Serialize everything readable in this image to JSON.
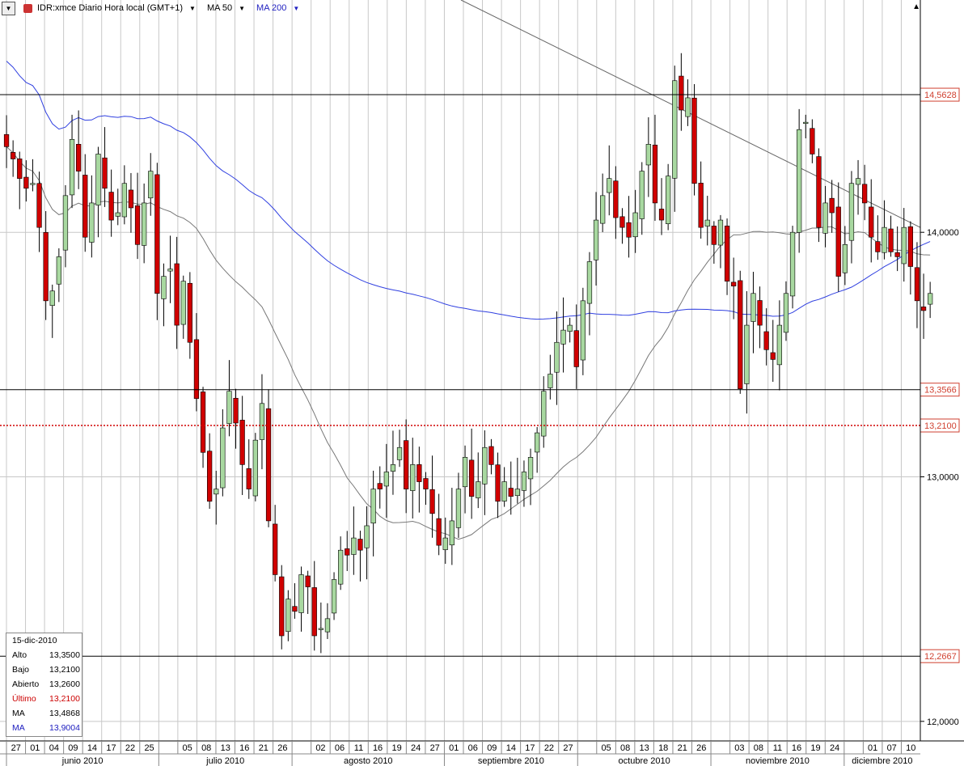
{
  "toolbar": {
    "symbol": "IDR:xmce Diario Hora local (GMT+1)",
    "ma50_label": "MA 50",
    "ma200_label": "MA 200",
    "ma50_color": "#000000",
    "ma200_color": "#2020c0"
  },
  "info": {
    "date": "15-dic-2010",
    "rows": [
      {
        "label": "Alto",
        "value": "13,3500",
        "color": "#000000"
      },
      {
        "label": "Bajo",
        "value": "13,2100",
        "color": "#000000"
      },
      {
        "label": "Abierto",
        "value": "13,2600",
        "color": "#000000"
      },
      {
        "label": "Último",
        "value": "13,2100",
        "color": "#cc0000"
      },
      {
        "label": "MA",
        "value": "13,4868",
        "color": "#000000"
      },
      {
        "label": "MA",
        "value": "13,9004",
        "color": "#2020c0"
      }
    ]
  },
  "chart_data": {
    "type": "candlestick",
    "y_axis": {
      "range": [
        11.92,
        14.95
      ],
      "ticks": [
        {
          "v": 12.0,
          "label": "12,0000"
        },
        {
          "v": 13.0,
          "label": "13,0000"
        },
        {
          "v": 14.0,
          "label": "14,0000"
        }
      ],
      "markers": [
        {
          "v": 14.5628,
          "label": "14,5628",
          "style": "line"
        },
        {
          "v": 13.3566,
          "label": "13,3566",
          "style": "line"
        },
        {
          "v": 13.21,
          "label": "13,2100",
          "style": "dotted"
        },
        {
          "v": 12.2667,
          "label": "12,2667",
          "style": "line"
        }
      ]
    },
    "day_labels": [
      "27",
      "01",
      "04",
      "09",
      "14",
      "17",
      "22",
      "25",
      "",
      "05",
      "08",
      "13",
      "16",
      "21",
      "26",
      "",
      "02",
      "06",
      "11",
      "16",
      "19",
      "24",
      "27",
      "01",
      "06",
      "09",
      "14",
      "17",
      "22",
      "27",
      "",
      "05",
      "08",
      "13",
      "18",
      "21",
      "26",
      "",
      "03",
      "08",
      "11",
      "16",
      "19",
      "24",
      "",
      "01",
      "07",
      "10"
    ],
    "months": [
      {
        "label": "junio 2010",
        "start": 0,
        "end": 8
      },
      {
        "label": "julio 2010",
        "start": 8,
        "end": 15
      },
      {
        "label": "agosto 2010",
        "start": 15,
        "end": 23
      },
      {
        "label": "septiembre 2010",
        "start": 23,
        "end": 30
      },
      {
        "label": "octubre 2010",
        "start": 30,
        "end": 37
      },
      {
        "label": "noviembre 2010",
        "start": 37,
        "end": 44
      },
      {
        "label": "diciembre 2010",
        "start": 44,
        "end": 48
      }
    ],
    "candle_count": 140,
    "closes": [
      14.35,
      14.3,
      14.22,
      14.18,
      14.2,
      14.02,
      13.72,
      13.76,
      13.9,
      14.15,
      14.38,
      14.25,
      13.98,
      14.12,
      14.32,
      14.18,
      14.05,
      14.08,
      14.2,
      14.1,
      13.95,
      14.12,
      14.25,
      13.75,
      13.82,
      13.85,
      13.62,
      13.8,
      13.55,
      13.32,
      13.1,
      12.9,
      12.95,
      13.2,
      13.35,
      13.22,
      13.05,
      12.95,
      13.15,
      13.3,
      12.82,
      12.6,
      12.35,
      12.5,
      12.45,
      12.6,
      12.55,
      12.35,
      12.38,
      12.42,
      12.58,
      12.7,
      12.68,
      12.75,
      12.7,
      12.8,
      12.95,
      12.95,
      13.02,
      13.05,
      13.12,
      12.95,
      13.05,
      12.98,
      12.95,
      12.85,
      12.72,
      12.75,
      12.82,
      12.95,
      13.08,
      12.92,
      12.98,
      13.12,
      13.05,
      12.9,
      12.98,
      12.92,
      12.95,
      13.02,
      13.08,
      13.18,
      13.35,
      13.42,
      13.55,
      13.6,
      13.62,
      13.45,
      13.72,
      13.88,
      14.05,
      14.15,
      14.22,
      14.06,
      14.02,
      13.98,
      14.08,
      14.25,
      14.36,
      14.12,
      14.05,
      14.23,
      14.62,
      14.5,
      14.55,
      14.2,
      14.02,
      14.05,
      13.95,
      14.05,
      13.8,
      13.78,
      13.36,
      13.62,
      13.75,
      13.62,
      13.52,
      13.48,
      13.62,
      13.75,
      14.0,
      14.42,
      14.45,
      14.32,
      14.02,
      14.12,
      14.08,
      13.82,
      13.95,
      14.2,
      14.22,
      14.12,
      13.98,
      13.92,
      14.02,
      13.92,
      13.9,
      14.02,
      13.86,
      13.72,
      13.68,
      13.75
    ],
    "ma50_label": "MA 50",
    "ma200_label": "MA 200"
  }
}
